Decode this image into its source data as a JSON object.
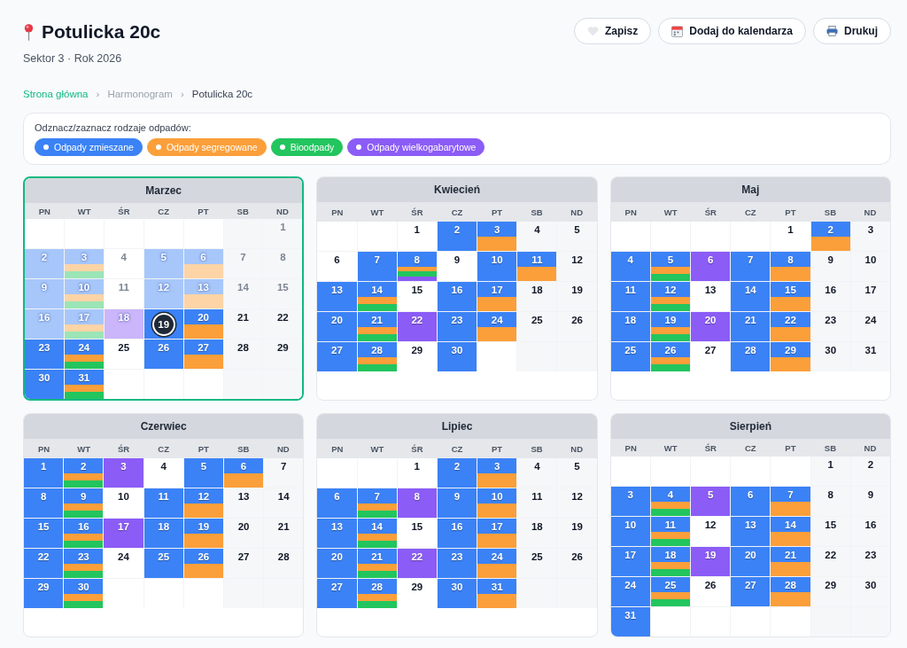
{
  "header": {
    "title": "Potulicka 20c",
    "subtitle": "Sektor 3 · Rok 2026"
  },
  "buttons": [
    {
      "kind": "save",
      "label": "Zapisz"
    },
    {
      "kind": "calendar",
      "label": "Dodaj do kalendarza"
    },
    {
      "kind": "print",
      "label": "Drukuj"
    }
  ],
  "breadcrumb": [
    {
      "label": "Strona główna",
      "kind": "link"
    },
    {
      "label": "Harmonogram",
      "kind": "muted"
    },
    {
      "label": "Potulicka 20c",
      "kind": "current"
    }
  ],
  "breadcrumb_separators": [
    "›",
    "›"
  ],
  "legend": {
    "label": "Odznacz/zaznacz rodzaje odpadów:",
    "items": [
      {
        "label": "Odpady zmieszane",
        "kind": "mixed",
        "color": "#3b82f6",
        "selected": true
      },
      {
        "label": "Odpady segregowane",
        "kind": "sorted",
        "color": "#fb9f3a",
        "selected": true
      },
      {
        "label": "Bioodpady",
        "kind": "bio",
        "color": "#22c55e",
        "selected": true
      },
      {
        "label": "Odpady wielkogabarytowe",
        "kind": "bulky",
        "color": "#8b5cf6",
        "selected": true
      }
    ]
  },
  "months": [
    {
      "name": "Marzec",
      "selected": true,
      "weekdays": [
        "PN",
        "WT",
        "ŚR",
        "CZ",
        "PT",
        "SB",
        "ND"
      ],
      "days": [
        {
          "kind": "empty"
        },
        {
          "kind": "empty"
        },
        {
          "kind": "empty"
        },
        {
          "kind": "empty"
        },
        {
          "kind": "empty"
        },
        {
          "kind": "empty"
        },
        {
          "kind": "past",
          "day": "1"
        },
        {
          "kind": "past",
          "day": "2",
          "bins": [
            {
              "kind": "mixed"
            }
          ]
        },
        {
          "kind": "past",
          "day": "3",
          "bins": [
            {
              "kind": "mixed"
            },
            {
              "kind": "sorted"
            },
            {
              "kind": "bio"
            }
          ]
        },
        {
          "kind": "past",
          "day": "4"
        },
        {
          "kind": "past",
          "day": "5",
          "bins": [
            {
              "kind": "mixed"
            }
          ]
        },
        {
          "kind": "past",
          "day": "6",
          "bins": [
            {
              "kind": "mixed"
            },
            {
              "kind": "sorted"
            }
          ]
        },
        {
          "kind": "past",
          "day": "7"
        },
        {
          "kind": "past",
          "day": "8"
        },
        {
          "kind": "past",
          "day": "9",
          "bins": [
            {
              "kind": "mixed"
            }
          ]
        },
        {
          "kind": "past",
          "day": "10",
          "bins": [
            {
              "kind": "mixed"
            },
            {
              "kind": "sorted"
            },
            {
              "kind": "bio"
            }
          ]
        },
        {
          "kind": "past",
          "day": "11"
        },
        {
          "kind": "past",
          "day": "12",
          "bins": [
            {
              "kind": "mixed"
            }
          ]
        },
        {
          "kind": "past",
          "day": "13",
          "bins": [
            {
              "kind": "mixed"
            },
            {
              "kind": "sorted"
            }
          ]
        },
        {
          "kind": "past",
          "day": "14"
        },
        {
          "kind": "past",
          "day": "15"
        },
        {
          "kind": "past",
          "day": "16",
          "bins": [
            {
              "kind": "mixed"
            }
          ]
        },
        {
          "kind": "past",
          "day": "17",
          "bins": [
            {
              "kind": "mixed"
            },
            {
              "kind": "sorted"
            },
            {
              "kind": "bio"
            }
          ]
        },
        {
          "kind": "past",
          "day": "18",
          "bins": [
            {
              "kind": "bulky"
            }
          ]
        },
        {
          "kind": "today",
          "day": "19",
          "bins": [
            {
              "kind": "mixed"
            }
          ]
        },
        {
          "kind": "day",
          "day": "20",
          "bins": [
            {
              "kind": "mixed"
            },
            {
              "kind": "sorted"
            }
          ]
        },
        {
          "kind": "day",
          "day": "21"
        },
        {
          "kind": "day",
          "day": "22"
        },
        {
          "kind": "day",
          "day": "23",
          "bins": [
            {
              "kind": "mixed"
            }
          ]
        },
        {
          "kind": "day",
          "day": "24",
          "bins": [
            {
              "kind": "mixed"
            },
            {
              "kind": "sorted"
            },
            {
              "kind": "bio"
            }
          ]
        },
        {
          "kind": "day",
          "day": "25"
        },
        {
          "kind": "day",
          "day": "26",
          "bins": [
            {
              "kind": "mixed"
            }
          ]
        },
        {
          "kind": "day",
          "day": "27",
          "bins": [
            {
              "kind": "mixed"
            },
            {
              "kind": "sorted"
            }
          ]
        },
        {
          "kind": "day",
          "day": "28"
        },
        {
          "kind": "day",
          "day": "29"
        },
        {
          "kind": "day",
          "day": "30",
          "bins": [
            {
              "kind": "mixed"
            }
          ]
        },
        {
          "kind": "day",
          "day": "31",
          "bins": [
            {
              "kind": "mixed"
            },
            {
              "kind": "sorted"
            },
            {
              "kind": "bio"
            }
          ]
        }
      ]
    },
    {
      "name": "Kwiecień",
      "selected": false,
      "weekdays": [
        "PN",
        "WT",
        "ŚR",
        "CZ",
        "PT",
        "SB",
        "ND"
      ],
      "days": [
        {
          "kind": "empty"
        },
        {
          "kind": "empty"
        },
        {
          "kind": "day",
          "day": "1"
        },
        {
          "kind": "day",
          "day": "2",
          "bins": [
            {
              "kind": "mixed"
            }
          ]
        },
        {
          "kind": "day",
          "day": "3",
          "bins": [
            {
              "kind": "mixed"
            },
            {
              "kind": "sorted"
            }
          ]
        },
        {
          "kind": "day",
          "day": "4"
        },
        {
          "kind": "day",
          "day": "5"
        },
        {
          "kind": "day",
          "day": "6"
        },
        {
          "kind": "day",
          "day": "7",
          "bins": [
            {
              "kind": "mixed"
            }
          ]
        },
        {
          "kind": "day",
          "day": "8",
          "bins": [
            {
              "kind": "mixed"
            },
            {
              "kind": "sorted"
            },
            {
              "kind": "bio"
            },
            {
              "kind": "bulky"
            }
          ]
        },
        {
          "kind": "day",
          "day": "9"
        },
        {
          "kind": "day",
          "day": "10",
          "bins": [
            {
              "kind": "mixed"
            }
          ]
        },
        {
          "kind": "day",
          "day": "11",
          "bins": [
            {
              "kind": "mixed"
            },
            {
              "kind": "sorted"
            }
          ]
        },
        {
          "kind": "day",
          "day": "12"
        },
        {
          "kind": "day",
          "day": "13",
          "bins": [
            {
              "kind": "mixed"
            }
          ]
        },
        {
          "kind": "day",
          "day": "14",
          "bins": [
            {
              "kind": "mixed"
            },
            {
              "kind": "sorted"
            },
            {
              "kind": "bio"
            }
          ]
        },
        {
          "kind": "day",
          "day": "15"
        },
        {
          "kind": "day",
          "day": "16",
          "bins": [
            {
              "kind": "mixed"
            }
          ]
        },
        {
          "kind": "day",
          "day": "17",
          "bins": [
            {
              "kind": "mixed"
            },
            {
              "kind": "sorted"
            }
          ]
        },
        {
          "kind": "day",
          "day": "18"
        },
        {
          "kind": "day",
          "day": "19"
        },
        {
          "kind": "day",
          "day": "20",
          "bins": [
            {
              "kind": "mixed"
            }
          ]
        },
        {
          "kind": "day",
          "day": "21",
          "bins": [
            {
              "kind": "mixed"
            },
            {
              "kind": "sorted"
            },
            {
              "kind": "bio"
            }
          ]
        },
        {
          "kind": "day",
          "day": "22",
          "bins": [
            {
              "kind": "bulky"
            }
          ]
        },
        {
          "kind": "day",
          "day": "23",
          "bins": [
            {
              "kind": "mixed"
            }
          ]
        },
        {
          "kind": "day",
          "day": "24",
          "bins": [
            {
              "kind": "mixed"
            },
            {
              "kind": "sorted"
            }
          ]
        },
        {
          "kind": "day",
          "day": "25"
        },
        {
          "kind": "day",
          "day": "26"
        },
        {
          "kind": "day",
          "day": "27",
          "bins": [
            {
              "kind": "mixed"
            }
          ]
        },
        {
          "kind": "day",
          "day": "28",
          "bins": [
            {
              "kind": "mixed"
            },
            {
              "kind": "sorted"
            },
            {
              "kind": "bio"
            }
          ]
        },
        {
          "kind": "day",
          "day": "29"
        },
        {
          "kind": "day",
          "day": "30",
          "bins": [
            {
              "kind": "mixed"
            }
          ]
        }
      ]
    },
    {
      "name": "Maj",
      "selected": false,
      "weekdays": [
        "PN",
        "WT",
        "ŚR",
        "CZ",
        "PT",
        "SB",
        "ND"
      ],
      "days": [
        {
          "kind": "empty"
        },
        {
          "kind": "empty"
        },
        {
          "kind": "empty"
        },
        {
          "kind": "empty"
        },
        {
          "kind": "day",
          "day": "1"
        },
        {
          "kind": "day",
          "day": "2",
          "bins": [
            {
              "kind": "mixed"
            },
            {
              "kind": "sorted"
            }
          ]
        },
        {
          "kind": "day",
          "day": "3"
        },
        {
          "kind": "day",
          "day": "4",
          "bins": [
            {
              "kind": "mixed"
            }
          ]
        },
        {
          "kind": "day",
          "day": "5",
          "bins": [
            {
              "kind": "mixed"
            },
            {
              "kind": "sorted"
            },
            {
              "kind": "bio"
            }
          ]
        },
        {
          "kind": "day",
          "day": "6",
          "bins": [
            {
              "kind": "bulky"
            }
          ]
        },
        {
          "kind": "day",
          "day": "7",
          "bins": [
            {
              "kind": "mixed"
            }
          ]
        },
        {
          "kind": "day",
          "day": "8",
          "bins": [
            {
              "kind": "mixed"
            },
            {
              "kind": "sorted"
            }
          ]
        },
        {
          "kind": "day",
          "day": "9"
        },
        {
          "kind": "day",
          "day": "10"
        },
        {
          "kind": "day",
          "day": "11",
          "bins": [
            {
              "kind": "mixed"
            }
          ]
        },
        {
          "kind": "day",
          "day": "12",
          "bins": [
            {
              "kind": "mixed"
            },
            {
              "kind": "sorted"
            },
            {
              "kind": "bio"
            }
          ]
        },
        {
          "kind": "day",
          "day": "13"
        },
        {
          "kind": "day",
          "day": "14",
          "bins": [
            {
              "kind": "mixed"
            }
          ]
        },
        {
          "kind": "day",
          "day": "15",
          "bins": [
            {
              "kind": "mixed"
            },
            {
              "kind": "sorted"
            }
          ]
        },
        {
          "kind": "day",
          "day": "16"
        },
        {
          "kind": "day",
          "day": "17"
        },
        {
          "kind": "day",
          "day": "18",
          "bins": [
            {
              "kind": "mixed"
            }
          ]
        },
        {
          "kind": "day",
          "day": "19",
          "bins": [
            {
              "kind": "mixed"
            },
            {
              "kind": "sorted"
            },
            {
              "kind": "bio"
            }
          ]
        },
        {
          "kind": "day",
          "day": "20",
          "bins": [
            {
              "kind": "bulky"
            }
          ]
        },
        {
          "kind": "day",
          "day": "21",
          "bins": [
            {
              "kind": "mixed"
            }
          ]
        },
        {
          "kind": "day",
          "day": "22",
          "bins": [
            {
              "kind": "mixed"
            },
            {
              "kind": "sorted"
            }
          ]
        },
        {
          "kind": "day",
          "day": "23"
        },
        {
          "kind": "day",
          "day": "24"
        },
        {
          "kind": "day",
          "day": "25",
          "bins": [
            {
              "kind": "mixed"
            }
          ]
        },
        {
          "kind": "day",
          "day": "26",
          "bins": [
            {
              "kind": "mixed"
            },
            {
              "kind": "sorted"
            },
            {
              "kind": "bio"
            }
          ]
        },
        {
          "kind": "day",
          "day": "27"
        },
        {
          "kind": "day",
          "day": "28",
          "bins": [
            {
              "kind": "mixed"
            }
          ]
        },
        {
          "kind": "day",
          "day": "29",
          "bins": [
            {
              "kind": "mixed"
            },
            {
              "kind": "sorted"
            }
          ]
        },
        {
          "kind": "day",
          "day": "30"
        },
        {
          "kind": "day",
          "day": "31"
        }
      ]
    },
    {
      "name": "Czerwiec",
      "selected": false,
      "weekdays": [
        "PN",
        "WT",
        "ŚR",
        "CZ",
        "PT",
        "SB",
        "ND"
      ],
      "days": [
        {
          "kind": "day",
          "day": "1",
          "bins": [
            {
              "kind": "mixed"
            }
          ]
        },
        {
          "kind": "day",
          "day": "2",
          "bins": [
            {
              "kind": "mixed"
            },
            {
              "kind": "sorted"
            },
            {
              "kind": "bio"
            }
          ]
        },
        {
          "kind": "day",
          "day": "3",
          "bins": [
            {
              "kind": "bulky"
            }
          ]
        },
        {
          "kind": "day",
          "day": "4"
        },
        {
          "kind": "day",
          "day": "5",
          "bins": [
            {
              "kind": "mixed"
            }
          ]
        },
        {
          "kind": "day",
          "day": "6",
          "bins": [
            {
              "kind": "mixed"
            },
            {
              "kind": "sorted"
            }
          ]
        },
        {
          "kind": "day",
          "day": "7"
        },
        {
          "kind": "day",
          "day": "8",
          "bins": [
            {
              "kind": "mixed"
            }
          ]
        },
        {
          "kind": "day",
          "day": "9",
          "bins": [
            {
              "kind": "mixed"
            },
            {
              "kind": "sorted"
            },
            {
              "kind": "bio"
            }
          ]
        },
        {
          "kind": "day",
          "day": "10"
        },
        {
          "kind": "day",
          "day": "11",
          "bins": [
            {
              "kind": "mixed"
            }
          ]
        },
        {
          "kind": "day",
          "day": "12",
          "bins": [
            {
              "kind": "mixed"
            },
            {
              "kind": "sorted"
            }
          ]
        },
        {
          "kind": "day",
          "day": "13"
        },
        {
          "kind": "day",
          "day": "14"
        },
        {
          "kind": "day",
          "day": "15",
          "bins": [
            {
              "kind": "mixed"
            }
          ]
        },
        {
          "kind": "day",
          "day": "16",
          "bins": [
            {
              "kind": "mixed"
            },
            {
              "kind": "sorted"
            },
            {
              "kind": "bio"
            }
          ]
        },
        {
          "kind": "day",
          "day": "17",
          "bins": [
            {
              "kind": "bulky"
            }
          ]
        },
        {
          "kind": "day",
          "day": "18",
          "bins": [
            {
              "kind": "mixed"
            }
          ]
        },
        {
          "kind": "day",
          "day": "19",
          "bins": [
            {
              "kind": "mixed"
            },
            {
              "kind": "sorted"
            }
          ]
        },
        {
          "kind": "day",
          "day": "20"
        },
        {
          "kind": "day",
          "day": "21"
        },
        {
          "kind": "day",
          "day": "22",
          "bins": [
            {
              "kind": "mixed"
            }
          ]
        },
        {
          "kind": "day",
          "day": "23",
          "bins": [
            {
              "kind": "mixed"
            },
            {
              "kind": "sorted"
            },
            {
              "kind": "bio"
            }
          ]
        },
        {
          "kind": "day",
          "day": "24"
        },
        {
          "kind": "day",
          "day": "25",
          "bins": [
            {
              "kind": "mixed"
            }
          ]
        },
        {
          "kind": "day",
          "day": "26",
          "bins": [
            {
              "kind": "mixed"
            },
            {
              "kind": "sorted"
            }
          ]
        },
        {
          "kind": "day",
          "day": "27"
        },
        {
          "kind": "day",
          "day": "28"
        },
        {
          "kind": "day",
          "day": "29",
          "bins": [
            {
              "kind": "mixed"
            }
          ]
        },
        {
          "kind": "day",
          "day": "30",
          "bins": [
            {
              "kind": "mixed"
            },
            {
              "kind": "sorted"
            },
            {
              "kind": "bio"
            }
          ]
        }
      ]
    },
    {
      "name": "Lipiec",
      "selected": false,
      "weekdays": [
        "PN",
        "WT",
        "ŚR",
        "CZ",
        "PT",
        "SB",
        "ND"
      ],
      "days": [
        {
          "kind": "empty"
        },
        {
          "kind": "empty"
        },
        {
          "kind": "day",
          "day": "1"
        },
        {
          "kind": "day",
          "day": "2",
          "bins": [
            {
              "kind": "mixed"
            }
          ]
        },
        {
          "kind": "day",
          "day": "3",
          "bins": [
            {
              "kind": "mixed"
            },
            {
              "kind": "sorted"
            }
          ]
        },
        {
          "kind": "day",
          "day": "4"
        },
        {
          "kind": "day",
          "day": "5"
        },
        {
          "kind": "day",
          "day": "6",
          "bins": [
            {
              "kind": "mixed"
            }
          ]
        },
        {
          "kind": "day",
          "day": "7",
          "bins": [
            {
              "kind": "mixed"
            },
            {
              "kind": "sorted"
            },
            {
              "kind": "bio"
            }
          ]
        },
        {
          "kind": "day",
          "day": "8",
          "bins": [
            {
              "kind": "bulky"
            }
          ]
        },
        {
          "kind": "day",
          "day": "9",
          "bins": [
            {
              "kind": "mixed"
            }
          ]
        },
        {
          "kind": "day",
          "day": "10",
          "bins": [
            {
              "kind": "mixed"
            },
            {
              "kind": "sorted"
            }
          ]
        },
        {
          "kind": "day",
          "day": "11"
        },
        {
          "kind": "day",
          "day": "12"
        },
        {
          "kind": "day",
          "day": "13",
          "bins": [
            {
              "kind": "mixed"
            }
          ]
        },
        {
          "kind": "day",
          "day": "14",
          "bins": [
            {
              "kind": "mixed"
            },
            {
              "kind": "sorted"
            },
            {
              "kind": "bio"
            }
          ]
        },
        {
          "kind": "day",
          "day": "15"
        },
        {
          "kind": "day",
          "day": "16",
          "bins": [
            {
              "kind": "mixed"
            }
          ]
        },
        {
          "kind": "day",
          "day": "17",
          "bins": [
            {
              "kind": "mixed"
            },
            {
              "kind": "sorted"
            }
          ]
        },
        {
          "kind": "day",
          "day": "18"
        },
        {
          "kind": "day",
          "day": "19"
        },
        {
          "kind": "day",
          "day": "20",
          "bins": [
            {
              "kind": "mixed"
            }
          ]
        },
        {
          "kind": "day",
          "day": "21",
          "bins": [
            {
              "kind": "mixed"
            },
            {
              "kind": "sorted"
            },
            {
              "kind": "bio"
            }
          ]
        },
        {
          "kind": "day",
          "day": "22",
          "bins": [
            {
              "kind": "bulky"
            }
          ]
        },
        {
          "kind": "day",
          "day": "23",
          "bins": [
            {
              "kind": "mixed"
            }
          ]
        },
        {
          "kind": "day",
          "day": "24",
          "bins": [
            {
              "kind": "mixed"
            },
            {
              "kind": "sorted"
            }
          ]
        },
        {
          "kind": "day",
          "day": "25"
        },
        {
          "kind": "day",
          "day": "26"
        },
        {
          "kind": "day",
          "day": "27",
          "bins": [
            {
              "kind": "mixed"
            }
          ]
        },
        {
          "kind": "day",
          "day": "28",
          "bins": [
            {
              "kind": "mixed"
            },
            {
              "kind": "sorted"
            },
            {
              "kind": "bio"
            }
          ]
        },
        {
          "kind": "day",
          "day": "29"
        },
        {
          "kind": "day",
          "day": "30",
          "bins": [
            {
              "kind": "mixed"
            }
          ]
        },
        {
          "kind": "day",
          "day": "31",
          "bins": [
            {
              "kind": "mixed"
            },
            {
              "kind": "sorted"
            }
          ]
        }
      ]
    },
    {
      "name": "Sierpień",
      "selected": false,
      "weekdays": [
        "PN",
        "WT",
        "ŚR",
        "CZ",
        "PT",
        "SB",
        "ND"
      ],
      "days": [
        {
          "kind": "empty"
        },
        {
          "kind": "empty"
        },
        {
          "kind": "empty"
        },
        {
          "kind": "empty"
        },
        {
          "kind": "empty"
        },
        {
          "kind": "day",
          "day": "1"
        },
        {
          "kind": "day",
          "day": "2"
        },
        {
          "kind": "day",
          "day": "3",
          "bins": [
            {
              "kind": "mixed"
            }
          ]
        },
        {
          "kind": "day",
          "day": "4",
          "bins": [
            {
              "kind": "mixed"
            },
            {
              "kind": "sorted"
            },
            {
              "kind": "bio"
            }
          ]
        },
        {
          "kind": "day",
          "day": "5",
          "bins": [
            {
              "kind": "bulky"
            }
          ]
        },
        {
          "kind": "day",
          "day": "6",
          "bins": [
            {
              "kind": "mixed"
            }
          ]
        },
        {
          "kind": "day",
          "day": "7",
          "bins": [
            {
              "kind": "mixed"
            },
            {
              "kind": "sorted"
            }
          ]
        },
        {
          "kind": "day",
          "day": "8"
        },
        {
          "kind": "day",
          "day": "9"
        },
        {
          "kind": "day",
          "day": "10",
          "bins": [
            {
              "kind": "mixed"
            }
          ]
        },
        {
          "kind": "day",
          "day": "11",
          "bins": [
            {
              "kind": "mixed"
            },
            {
              "kind": "sorted"
            },
            {
              "kind": "bio"
            }
          ]
        },
        {
          "kind": "day",
          "day": "12"
        },
        {
          "kind": "day",
          "day": "13",
          "bins": [
            {
              "kind": "mixed"
            }
          ]
        },
        {
          "kind": "day",
          "day": "14",
          "bins": [
            {
              "kind": "mixed"
            },
            {
              "kind": "sorted"
            }
          ]
        },
        {
          "kind": "day",
          "day": "15"
        },
        {
          "kind": "day",
          "day": "16"
        },
        {
          "kind": "day",
          "day": "17",
          "bins": [
            {
              "kind": "mixed"
            }
          ]
        },
        {
          "kind": "day",
          "day": "18",
          "bins": [
            {
              "kind": "mixed"
            },
            {
              "kind": "sorted"
            },
            {
              "kind": "bio"
            }
          ]
        },
        {
          "kind": "day",
          "day": "19",
          "bins": [
            {
              "kind": "bulky"
            }
          ]
        },
        {
          "kind": "day",
          "day": "20",
          "bins": [
            {
              "kind": "mixed"
            }
          ]
        },
        {
          "kind": "day",
          "day": "21",
          "bins": [
            {
              "kind": "mixed"
            },
            {
              "kind": "sorted"
            }
          ]
        },
        {
          "kind": "day",
          "day": "22"
        },
        {
          "kind": "day",
          "day": "23"
        },
        {
          "kind": "day",
          "day": "24",
          "bins": [
            {
              "kind": "mixed"
            }
          ]
        },
        {
          "kind": "day",
          "day": "25",
          "bins": [
            {
              "kind": "mixed"
            },
            {
              "kind": "sorted"
            },
            {
              "kind": "bio"
            }
          ]
        },
        {
          "kind": "day",
          "day": "26"
        },
        {
          "kind": "day",
          "day": "27",
          "bins": [
            {
              "kind": "mixed"
            }
          ]
        },
        {
          "kind": "day",
          "day": "28",
          "bins": [
            {
              "kind": "mixed"
            },
            {
              "kind": "sorted"
            }
          ]
        },
        {
          "kind": "day",
          "day": "29"
        },
        {
          "kind": "day",
          "day": "30"
        },
        {
          "kind": "day",
          "day": "31",
          "bins": [
            {
              "kind": "mixed"
            }
          ]
        }
      ]
    }
  ]
}
